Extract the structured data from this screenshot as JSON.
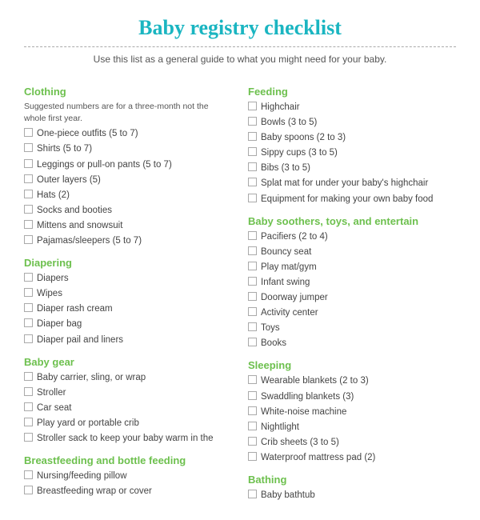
{
  "title": "Baby registry checklist",
  "subtitle": "Use this list as a general guide to what you might need for your baby.",
  "left_sections": [
    {
      "id": "clothing",
      "title": "Clothing",
      "note": "Suggested numbers are for a three-month not the whole first year.",
      "items": [
        "One-piece outfits (5 to 7)",
        "Shirts (5 to 7)",
        "Leggings or pull-on pants (5 to 7)",
        "Outer layers (5)",
        "Hats (2)",
        "Socks and booties",
        "Mittens and snowsuit",
        "Pajamas/sleepers (5 to 7)"
      ]
    },
    {
      "id": "diapering",
      "title": "Diapering",
      "note": "",
      "items": [
        "Diapers",
        "Wipes",
        "Diaper rash cream",
        "Diaper bag",
        "Diaper pail and liners"
      ]
    },
    {
      "id": "baby-gear",
      "title": "Baby gear",
      "note": "",
      "items": [
        "Baby carrier, sling, or wrap",
        "Stroller",
        "Car seat",
        "Play yard or portable crib",
        "Stroller sack to keep your baby warm in the"
      ]
    },
    {
      "id": "breastfeeding",
      "title": "Breastfeeding and bottle feeding",
      "note": "",
      "items": [
        "Nursing/feeding pillow",
        "Breastfeeding wrap or cover"
      ]
    }
  ],
  "right_sections": [
    {
      "id": "feeding",
      "title": "Feeding",
      "note": "",
      "items": [
        "Highchair",
        "Bowls (3 to 5)",
        "Baby spoons (2 to 3)",
        "Sippy cups (3 to 5)",
        "Bibs (3 to 5)",
        "Splat mat for under your baby's highchair",
        "Equipment for making your own baby food"
      ]
    },
    {
      "id": "soothers",
      "title": "Baby soothers, toys, and entertain",
      "note": "",
      "items": [
        "Pacifiers (2 to 4)",
        "Bouncy seat",
        "Play mat/gym",
        "Infant swing",
        "Doorway jumper",
        "Activity center",
        "Toys",
        "Books"
      ]
    },
    {
      "id": "sleeping",
      "title": "Sleeping",
      "note": "",
      "items": [
        "Wearable blankets (2 to 3)",
        "Swaddling blankets (3)",
        "White-noise machine",
        "Nightlight",
        "Crib sheets (3 to 5)",
        "Waterproof mattress pad (2)"
      ]
    },
    {
      "id": "bathing",
      "title": "Bathing",
      "note": "",
      "items": [
        "Baby bathtub"
      ]
    }
  ]
}
